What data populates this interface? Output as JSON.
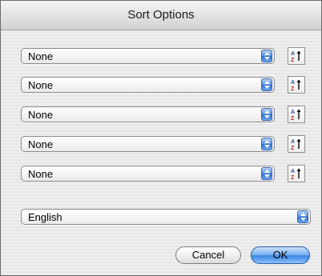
{
  "dialog": {
    "title": "Sort Options"
  },
  "sort_fields": [
    {
      "value": "None",
      "order_icon": "sort-ascending-az-icon"
    },
    {
      "value": "None",
      "order_icon": "sort-ascending-az-icon"
    },
    {
      "value": "None",
      "order_icon": "sort-ascending-az-icon"
    },
    {
      "value": "None",
      "order_icon": "sort-ascending-az-icon"
    },
    {
      "value": "None",
      "order_icon": "sort-ascending-az-icon"
    }
  ],
  "language": {
    "value": "English"
  },
  "buttons": {
    "cancel_label": "Cancel",
    "ok_label": "OK"
  },
  "colors": {
    "default_button": "#3c86e6",
    "popup_arrow": "#4f8fe4"
  }
}
